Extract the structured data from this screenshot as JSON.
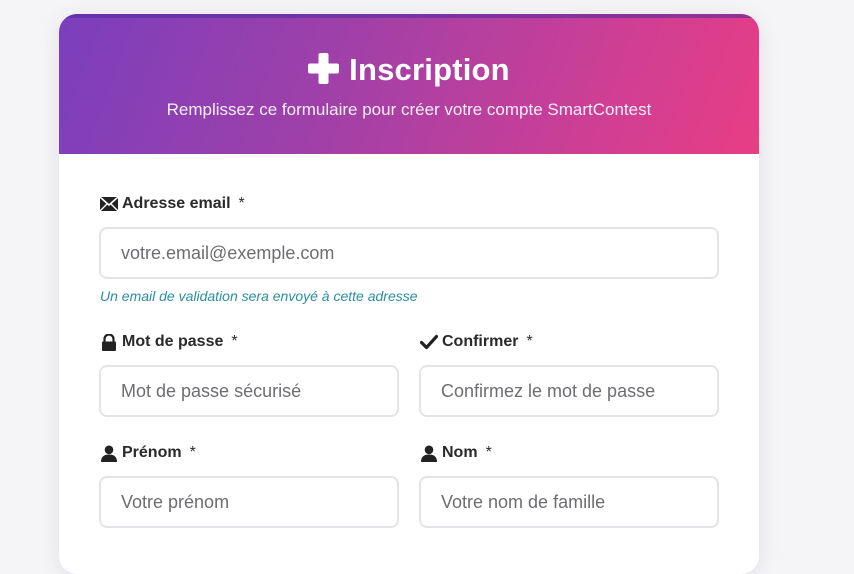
{
  "header": {
    "title": "Inscription",
    "subtitle": "Remplissez ce formulaire pour créer votre compte SmartContest",
    "title_icon": "plus-icon",
    "gradient_start": "#7b3fbd",
    "gradient_end": "#e83e84"
  },
  "form": {
    "email": {
      "label": "Adresse email",
      "required_mark": "*",
      "icon": "envelope-icon",
      "placeholder": "votre.email@exemple.com",
      "value": "",
      "hint": "Un email de validation sera envoyé à cette adresse"
    },
    "password": {
      "label": "Mot de passe",
      "required_mark": "*",
      "icon": "lock-icon",
      "placeholder": "Mot de passe sécurisé",
      "value": ""
    },
    "confirm": {
      "label": "Confirmer",
      "required_mark": "*",
      "icon": "checkmark-icon",
      "placeholder": "Confirmez le mot de passe",
      "value": ""
    },
    "first_name": {
      "label": "Prénom",
      "required_mark": "*",
      "icon": "user-icon",
      "placeholder": "Votre prénom",
      "value": ""
    },
    "last_name": {
      "label": "Nom",
      "required_mark": "*",
      "icon": "user-icon",
      "placeholder": "Votre nom de famille",
      "value": ""
    }
  },
  "colors": {
    "hint": "#2a8fa0",
    "input_border": "#e4e4e8",
    "label_text": "#2a2a2a"
  }
}
